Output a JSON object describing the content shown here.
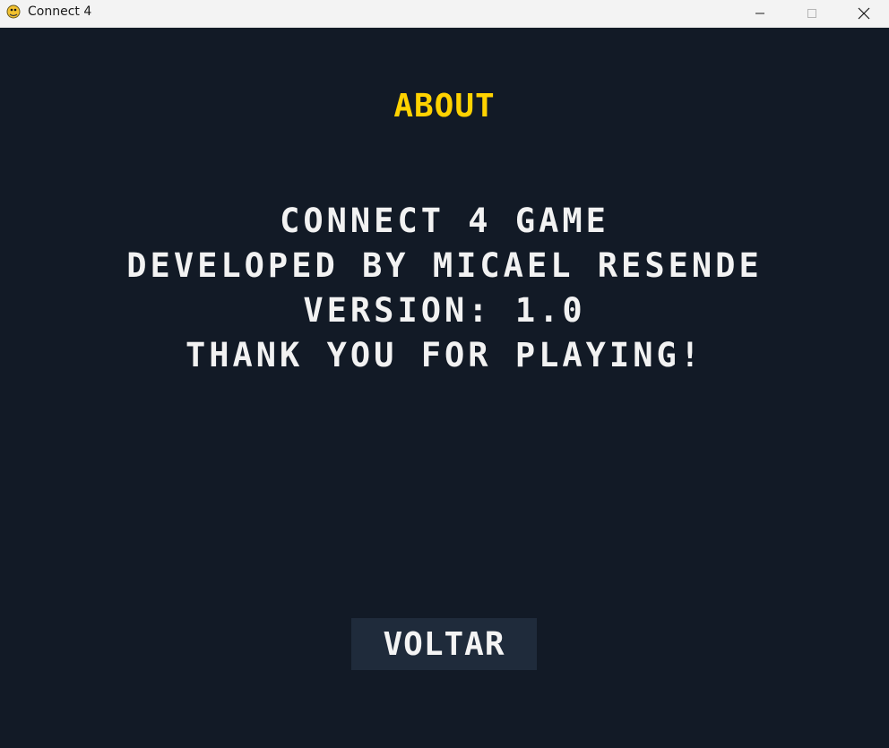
{
  "window": {
    "title": "Connect 4",
    "controls": {
      "minimize": "minimize-icon",
      "maximize": "maximize-icon",
      "close": "close-icon"
    }
  },
  "screen": {
    "heading": "ABOUT",
    "lines": [
      "CONNECT 4 GAME",
      "DEVELOPED BY MICAEL RESENDE",
      "VERSION: 1.0",
      "THANK YOU FOR PLAYING!"
    ],
    "back_button": "VOLTAR"
  },
  "colors": {
    "background": "#121a26",
    "heading": "#ffd200",
    "text": "#f2f2f2",
    "button_bg": "#1f2b3b"
  }
}
